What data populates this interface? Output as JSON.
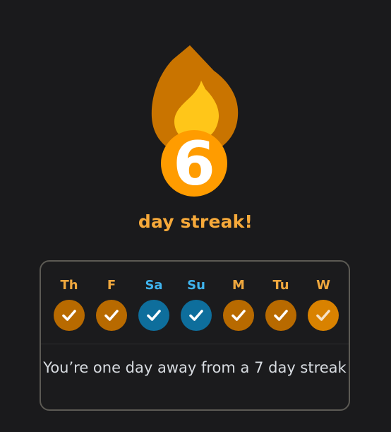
{
  "streak": {
    "count": "6",
    "title": "day streak!"
  },
  "colors": {
    "flame_outer": "#c97400",
    "flame_inner": "#ffc619",
    "number_ring": "#ff9c00",
    "title": "#f6a93a",
    "completed": "#b86a00",
    "freeze": "#0e6e9c",
    "today": "#d98200"
  },
  "week": [
    {
      "label": "Th",
      "status": "completed",
      "icon": "check-icon"
    },
    {
      "label": "F",
      "status": "completed",
      "icon": "check-icon"
    },
    {
      "label": "Sa",
      "status": "freeze",
      "icon": "check-icon"
    },
    {
      "label": "Su",
      "status": "freeze",
      "icon": "check-icon"
    },
    {
      "label": "M",
      "status": "completed",
      "icon": "check-icon"
    },
    {
      "label": "Tu",
      "status": "completed",
      "icon": "check-icon"
    },
    {
      "label": "W",
      "status": "today",
      "icon": "check-icon"
    }
  ],
  "message": "You’re one day away from a 7 day streak"
}
